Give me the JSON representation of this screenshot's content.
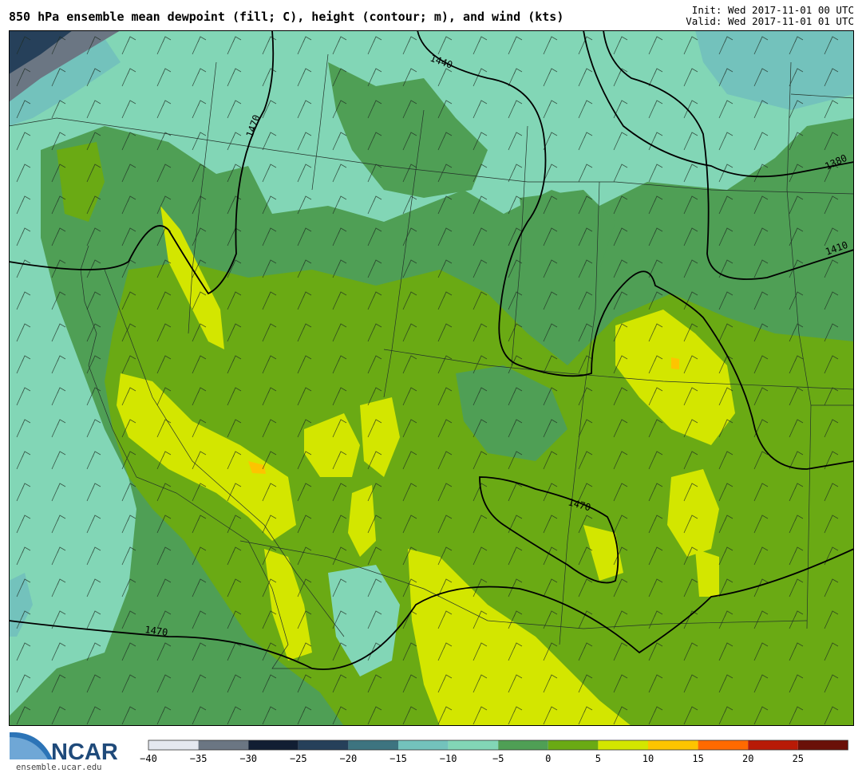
{
  "header": {
    "title": "850 hPa ensemble mean dewpoint (fill; C), height (contour; m), and wind (kts)",
    "init": "Init: Wed 2017-11-01 00 UTC",
    "valid": "Valid: Wed 2017-11-01 01 UTC"
  },
  "contour_labels": [
    "1440",
    "1470",
    "1380",
    "1410",
    "1470",
    "1470"
  ],
  "legend": {
    "ticks": [
      "−40",
      "−35",
      "−30",
      "−25",
      "−20",
      "−15",
      "−10",
      "−5",
      "0",
      "5",
      "10",
      "15",
      "20",
      "25"
    ],
    "colors": [
      "#e4e8f0",
      "#6b7683",
      "#111e33",
      "#26405a",
      "#3d7480",
      "#73c2bc",
      "#82d6b6",
      "#4f9f55",
      "#6aaa14",
      "#d3e600",
      "#fdc400",
      "#ff6a00",
      "#b81a06",
      "#6a1008"
    ]
  },
  "logo": {
    "name": "NCAR",
    "url": "ensemble.ucar.edu"
  }
}
